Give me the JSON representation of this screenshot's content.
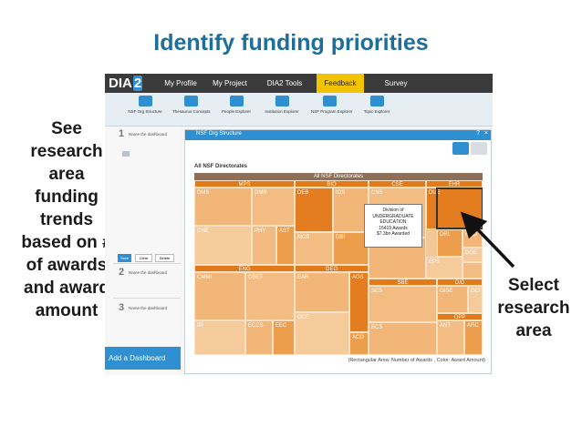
{
  "slide": {
    "title": "Identify funding priorities",
    "left_annotation": "See\nresearch\narea\nfunding\ntrends\nbased on #\nof awards\nand award\namount",
    "right_annotation": "Select\nresearch\narea"
  },
  "app": {
    "logo_text": "DIA",
    "logo_num": "2",
    "nav": [
      {
        "label": "My Profile"
      },
      {
        "label": "My Project"
      },
      {
        "label": "DIA2 Tools"
      },
      {
        "label": "Feedback",
        "active": true
      },
      {
        "label": "Survey"
      }
    ],
    "tools": [
      {
        "label": "NSF Org Structure",
        "icon": "org-structure-icon"
      },
      {
        "label": "Thesaurus Concepts",
        "icon": "thesaurus-icon"
      },
      {
        "label": "People Explorer",
        "icon": "people-icon"
      },
      {
        "label": "Institution Explorer",
        "icon": "institution-icon"
      },
      {
        "label": "NSF Program Explorer",
        "icon": "program-icon"
      },
      {
        "label": "Topic Explorer",
        "icon": "topic-icon"
      }
    ],
    "sidebar": {
      "steps": [
        {
          "num": "1",
          "label": "Name the dashboard"
        },
        {
          "num": "2",
          "label": "Name the dashboard"
        },
        {
          "num": "3",
          "label": "Name the dashboard"
        }
      ],
      "buttons": [
        "Save",
        "Clear",
        "Delete"
      ],
      "add_dashboard": "Add a Dashboard"
    },
    "panel": {
      "title": "NSF Org Structure",
      "controls": {
        "pin": "?",
        "close": "×"
      },
      "subtitle": "All NSF Directorates",
      "footer": "(Rectangular Area: Number of Awards , Color: Award Amount)"
    },
    "treemap": {
      "root_label": "All NSF Directorates",
      "headers": {
        "MPS": "MPS",
        "BIO": "BIO",
        "CSE": "CSE",
        "EHR": "EHR",
        "ENG": "ENG",
        "GEO": "GEO",
        "SBE": "SBE",
        "OD": "O/D",
        "OPP": "OPP"
      },
      "cells": {
        "DMS": "DMS",
        "DMR": "DMR",
        "CHE": "CHE",
        "PHY": "PHY",
        "AST": "AST",
        "DEB": "DEB",
        "IOS": "IOS",
        "MCB": "MCB",
        "DBI": "DBI",
        "CNS": "CNS",
        "DUE": "DUE",
        "DRL": "DRL",
        "HRD": "HRD",
        "DGE": "DGE",
        "EPS": "EPS",
        "CMMI": "CMMI",
        "CBET": "CBET",
        "IIP": "IIP",
        "ECCS": "ECCS",
        "EEC": "EEC",
        "EAR": "EAR",
        "AGS": "AGS",
        "OCE": "OCE",
        "ACD": "ACD",
        "SES": "SES",
        "BCS": "BCS",
        "OISE": "OISE",
        "OCI": "OCI",
        "ANT": "ANT",
        "ARC": "ARC"
      },
      "tooltip": [
        "Division of",
        "UNDERGRADUATE",
        "EDUCATION",
        "15419 Awards",
        "$7.3bn Awarded"
      ]
    }
  },
  "colors": {
    "accent_blue": "#2f8fd0",
    "title_blue": "#1f6e9a",
    "nav_active": "#f2c400",
    "treemap_dark": "#e17a1a",
    "treemap_light": "#f4c894"
  }
}
